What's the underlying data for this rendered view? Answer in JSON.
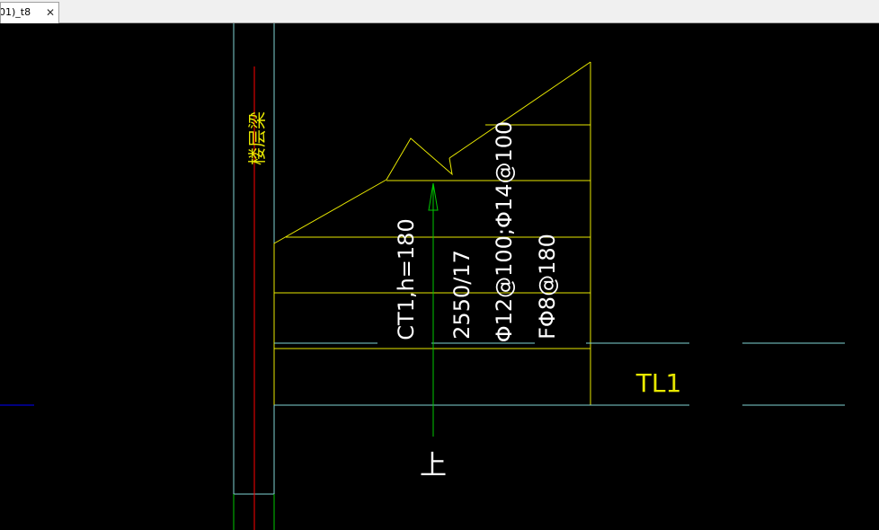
{
  "tabs": [
    {
      "label": "01)_t8",
      "close_glyph": "✕"
    }
  ],
  "drawing": {
    "beam_label": "楼层梁",
    "slab_code": "CT1,h=180",
    "steps": "2550/17",
    "bottom_rebar": "Φ12@100;Φ14@100",
    "distribution_rebar": "FΦ8@180",
    "stair_beam": "TL1",
    "direction": "上"
  },
  "colors": {
    "background": "#000000",
    "cyan": "#7fd4d4",
    "yellow": "#e8e800",
    "green": "#00c800",
    "red": "#ff0000",
    "blue": "#0000ff",
    "white": "#ffffff"
  }
}
